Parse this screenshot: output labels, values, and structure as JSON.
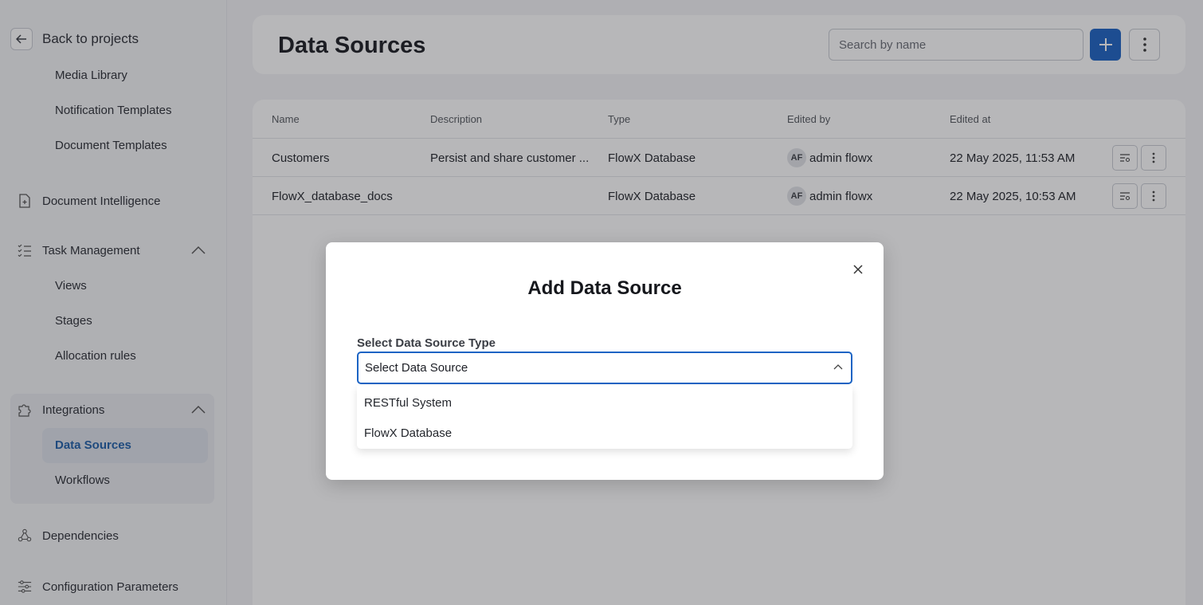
{
  "sidebar": {
    "back_label": "Back to projects",
    "items": [
      {
        "label": "Media Library"
      },
      {
        "label": "Notification Templates"
      },
      {
        "label": "Document Templates"
      },
      {
        "label": "Document Intelligence"
      },
      {
        "label": "Task Management"
      },
      {
        "label": "Views"
      },
      {
        "label": "Stages"
      },
      {
        "label": "Allocation rules"
      },
      {
        "label": "Integrations"
      },
      {
        "label": "Data Sources"
      },
      {
        "label": "Workflows"
      },
      {
        "label": "Dependencies"
      },
      {
        "label": "Configuration Parameters"
      }
    ],
    "active_item": "Data Sources"
  },
  "header": {
    "title": "Data Sources",
    "search_placeholder": "Search by name"
  },
  "table": {
    "columns": [
      "Name",
      "Description",
      "Type",
      "Edited by",
      "Edited at"
    ],
    "rows": [
      {
        "name": "Customers",
        "description": "Persist and share customer ...",
        "type": "FlowX Database",
        "avatar": "AF",
        "edited_by": "admin flowx",
        "edited_at": "22 May 2025, 11:53 AM"
      },
      {
        "name": "FlowX_database_docs",
        "description": "",
        "type": "FlowX Database",
        "avatar": "AF",
        "edited_by": "admin flowx",
        "edited_at": "22 May 2025, 10:53 AM"
      }
    ]
  },
  "modal": {
    "title": "Add Data Source",
    "field_label": "Select Data Source Type",
    "select_value": "Select Data Source",
    "options": [
      "RESTful System",
      "FlowX Database"
    ]
  },
  "colors": {
    "accent": "#1c64c4",
    "active_nav_text": "#1f5fa8"
  }
}
